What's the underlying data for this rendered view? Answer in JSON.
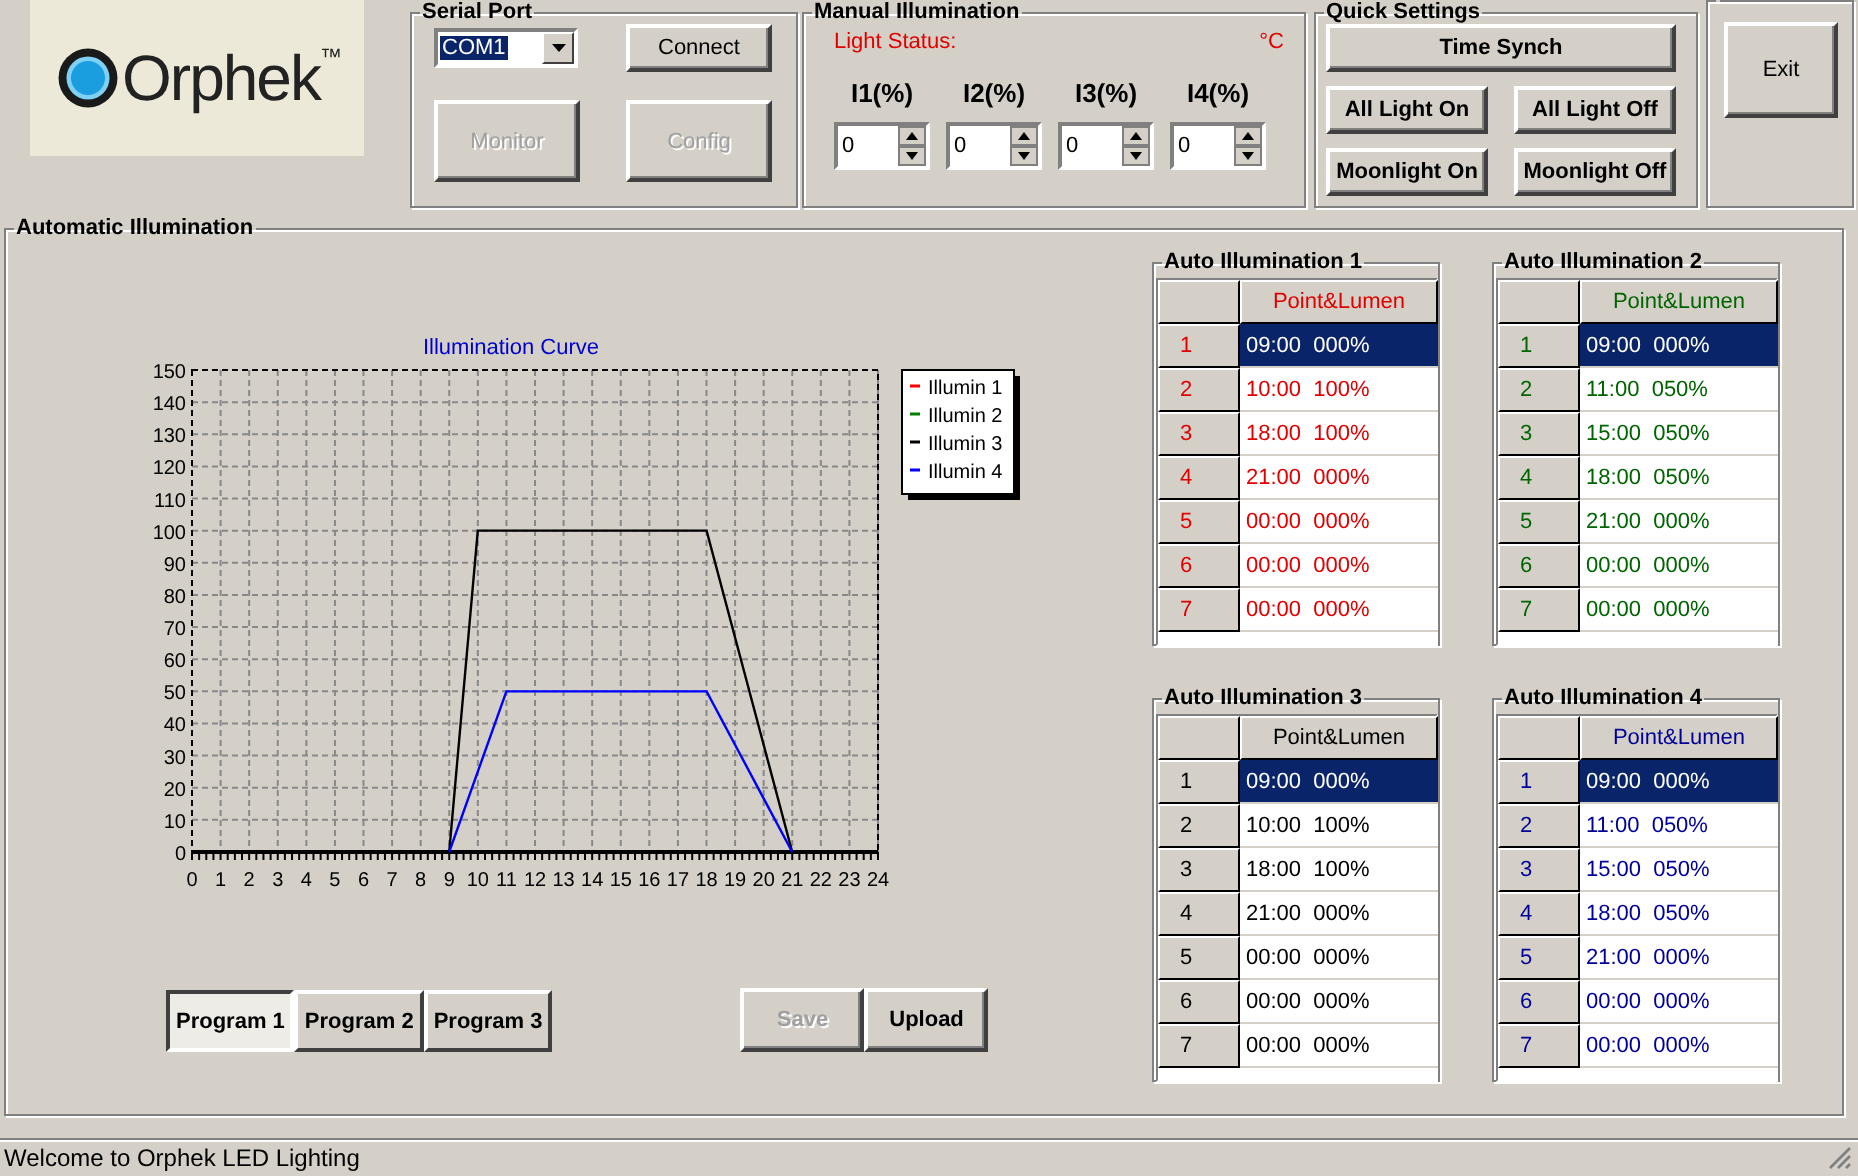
{
  "logo": {
    "text": "Orphek",
    "trademark": "™"
  },
  "serial_port": {
    "title": "Serial Port",
    "port": "COM1",
    "buttons": [
      {
        "label": "Connect",
        "disabled": false
      },
      {
        "label": "Monitor",
        "disabled": true
      },
      {
        "label": "Config",
        "disabled": true
      }
    ]
  },
  "manual_illumination": {
    "title": "Manual Illumination",
    "light_status": "Light Status:",
    "temperature_unit": "°C",
    "channels": [
      {
        "label": "I1(%)",
        "value": "0"
      },
      {
        "label": "I2(%)",
        "value": "0"
      },
      {
        "label": "I3(%)",
        "value": "0"
      },
      {
        "label": "I4(%)",
        "value": "0"
      }
    ]
  },
  "quick_settings": {
    "title": "Quick Settings",
    "buttons": [
      "Time Synch",
      "All Light On",
      "All Light Off",
      "Moonlight On",
      "Moonlight Off"
    ]
  },
  "exit_button": "Exit",
  "automatic_illumination": {
    "title": "Automatic Illumination",
    "chart": {
      "chart_data": {
        "type": "line",
        "title": "Illumination Curve",
        "x": [
          9,
          10,
          11,
          15,
          18,
          21
        ],
        "series": [
          {
            "name": "Illumin 1",
            "color": "#ff0000",
            "values": [
              null,
              null,
              null,
              null,
              null,
              null
            ]
          },
          {
            "name": "Illumin 2",
            "color": "#008000",
            "values": [
              null,
              null,
              null,
              null,
              null,
              null
            ]
          },
          {
            "name": "Illumin 3",
            "color": "#000000",
            "values": [
              0,
              100,
              100,
              100,
              100,
              0
            ]
          },
          {
            "name": "Illumin 4",
            "color": "#0000ff",
            "values": [
              0,
              25,
              50,
              50,
              50,
              0
            ]
          }
        ],
        "grid": true,
        "legend": "right",
        "xlim": [
          0,
          24
        ],
        "ylim": [
          0,
          150
        ],
        "xticks": [
          0,
          1,
          2,
          3,
          4,
          5,
          6,
          7,
          8,
          9,
          10,
          11,
          12,
          13,
          14,
          15,
          16,
          17,
          18,
          19,
          20,
          21,
          22,
          23,
          24
        ],
        "yticks": [
          0,
          10,
          20,
          30,
          40,
          50,
          60,
          70,
          80,
          90,
          100,
          110,
          120,
          130,
          140,
          150
        ]
      }
    },
    "programs": [
      {
        "label": "Program 1",
        "selected": true
      },
      {
        "label": "Program 2",
        "selected": false
      },
      {
        "label": "Program 3",
        "selected": false
      }
    ],
    "actions": [
      {
        "label": "Save",
        "disabled": true
      },
      {
        "label": "Upload",
        "disabled": false
      }
    ],
    "tables": [
      {
        "title": "Auto Illumination 1",
        "color": "#e00000",
        "header": "Point&Lumen",
        "rows": [
          {
            "index": "1",
            "value": "09:00  000%",
            "selected": true
          },
          {
            "index": "2",
            "value": "10:00  100%",
            "selected": false
          },
          {
            "index": "3",
            "value": "18:00  100%",
            "selected": false
          },
          {
            "index": "4",
            "value": "21:00  000%",
            "selected": false
          },
          {
            "index": "5",
            "value": "00:00  000%",
            "selected": false
          },
          {
            "index": "6",
            "value": "00:00  000%",
            "selected": false
          },
          {
            "index": "7",
            "value": "00:00  000%",
            "selected": false
          }
        ]
      },
      {
        "title": "Auto Illumination 2",
        "color": "#006400",
        "header": "Point&Lumen",
        "rows": [
          {
            "index": "1",
            "value": "09:00  000%",
            "selected": true
          },
          {
            "index": "2",
            "value": "11:00  050%",
            "selected": false
          },
          {
            "index": "3",
            "value": "15:00  050%",
            "selected": false
          },
          {
            "index": "4",
            "value": "18:00  050%",
            "selected": false
          },
          {
            "index": "5",
            "value": "21:00  000%",
            "selected": false
          },
          {
            "index": "6",
            "value": "00:00  000%",
            "selected": false
          },
          {
            "index": "7",
            "value": "00:00  000%",
            "selected": false
          }
        ]
      },
      {
        "title": "Auto Illumination 3",
        "color": "#000000",
        "header": "Point&Lumen",
        "rows": [
          {
            "index": "1",
            "value": "09:00  000%",
            "selected": true
          },
          {
            "index": "2",
            "value": "10:00  100%",
            "selected": false
          },
          {
            "index": "3",
            "value": "18:00  100%",
            "selected": false
          },
          {
            "index": "4",
            "value": "21:00  000%",
            "selected": false
          },
          {
            "index": "5",
            "value": "00:00  000%",
            "selected": false
          },
          {
            "index": "6",
            "value": "00:00  000%",
            "selected": false
          },
          {
            "index": "7",
            "value": "00:00  000%",
            "selected": false
          }
        ]
      },
      {
        "title": "Auto Illumination 4",
        "color": "#000099",
        "header": "Point&Lumen",
        "rows": [
          {
            "index": "1",
            "value": "09:00  000%",
            "selected": true
          },
          {
            "index": "2",
            "value": "11:00  050%",
            "selected": false
          },
          {
            "index": "3",
            "value": "15:00  050%",
            "selected": false
          },
          {
            "index": "4",
            "value": "18:00  050%",
            "selected": false
          },
          {
            "index": "5",
            "value": "21:00  000%",
            "selected": false
          },
          {
            "index": "6",
            "value": "00:00  000%",
            "selected": false
          },
          {
            "index": "7",
            "value": "00:00  000%",
            "selected": false
          }
        ]
      }
    ]
  },
  "status_bar": "Welcome to Orphek LED Lighting"
}
